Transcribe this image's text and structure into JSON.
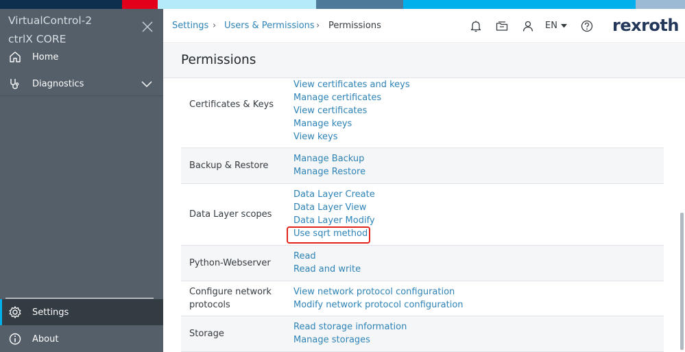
{
  "colors": {
    "topbar": [
      "#0f2f4e",
      "#e2001a",
      "#b4eafa",
      "#4e7999",
      "#00b0ec",
      "#9cbad4"
    ],
    "sidebar_bg": "#555f69",
    "sidebar_active_bg": "#333b43",
    "link": "#2d83b7",
    "highlight": "#e2231a",
    "brand": "#23375b"
  },
  "sidebar": {
    "device_name": "VirtualControl-2",
    "device_type": "ctrlX CORE",
    "close_icon": "close-icon",
    "items": [
      {
        "label": "Home",
        "icon": "home-icon"
      },
      {
        "label": "Diagnostics",
        "icon": "stethoscope-icon",
        "expand_icon": "chevron-down-icon"
      },
      {
        "label": "Settings",
        "icon": "gear-icon",
        "active": true
      },
      {
        "label": "About",
        "icon": "info-icon"
      }
    ]
  },
  "header": {
    "breadcrumb": [
      "Settings",
      "Users & Permissions",
      "Permissions"
    ],
    "language": "EN",
    "icons": [
      "bell-icon",
      "folder-icon",
      "user-icon",
      "help-icon"
    ],
    "logo": "rexroth"
  },
  "page": {
    "title": "Permissions"
  },
  "permissions": [
    {
      "category": "Certificates & Keys",
      "items": [
        "View certificates and keys",
        "Manage certificates",
        "View certificates",
        "Manage keys",
        "View keys"
      ]
    },
    {
      "category": "Backup & Restore",
      "items": [
        "Manage Backup",
        "Manage Restore"
      ]
    },
    {
      "category": "Data Layer scopes",
      "items": [
        "Data Layer Create",
        "Data Layer View",
        "Data Layer Modify",
        "Use sqrt method"
      ]
    },
    {
      "category": "Python-Webserver",
      "items": [
        "Read",
        "Read and write"
      ]
    },
    {
      "category_lines": [
        "Configure network",
        "protocols"
      ],
      "items": [
        "View network protocol configuration",
        "Modify network protocol configuration"
      ]
    },
    {
      "category": "Storage",
      "items": [
        "Read storage information",
        "Manage storages"
      ]
    }
  ]
}
